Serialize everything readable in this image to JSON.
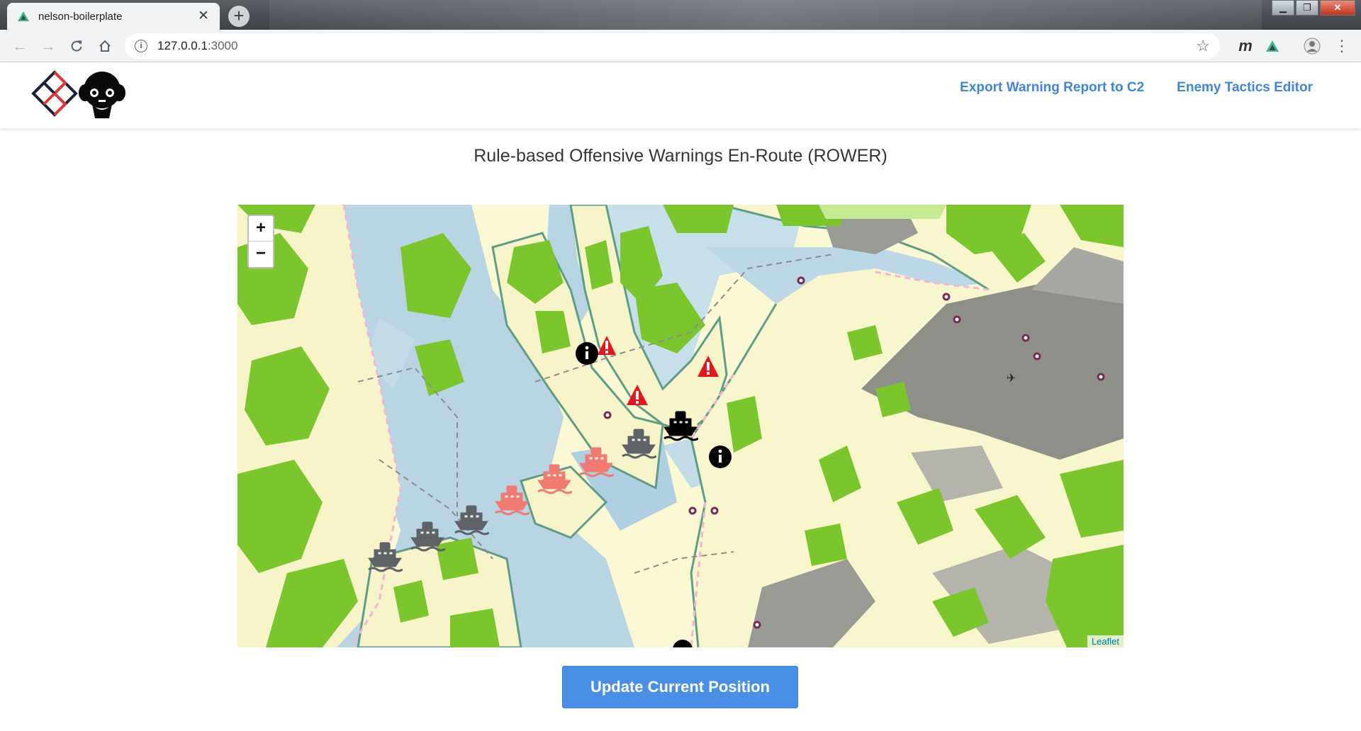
{
  "browser": {
    "tab_title": "nelson-boilerplate",
    "url_host": "127.0.0.1",
    "url_port": ":3000"
  },
  "header": {
    "nav": [
      {
        "label": "Export Warning Report to C2"
      },
      {
        "label": "Enemy Tactics Editor"
      }
    ]
  },
  "page": {
    "title": "Rule-based Offensive Warnings En-Route (ROWER)"
  },
  "map": {
    "zoom_in": "+",
    "zoom_out": "−",
    "attribution": "Leaflet"
  },
  "actions": {
    "update_position": "Update Current Position"
  },
  "colors": {
    "accent": "#4a8fe6",
    "link": "#3f86d8",
    "warning": "#e8141b",
    "ship_history": "#5f6368",
    "ship_predicted": "#ef7b72",
    "ship_current": "#000000"
  }
}
